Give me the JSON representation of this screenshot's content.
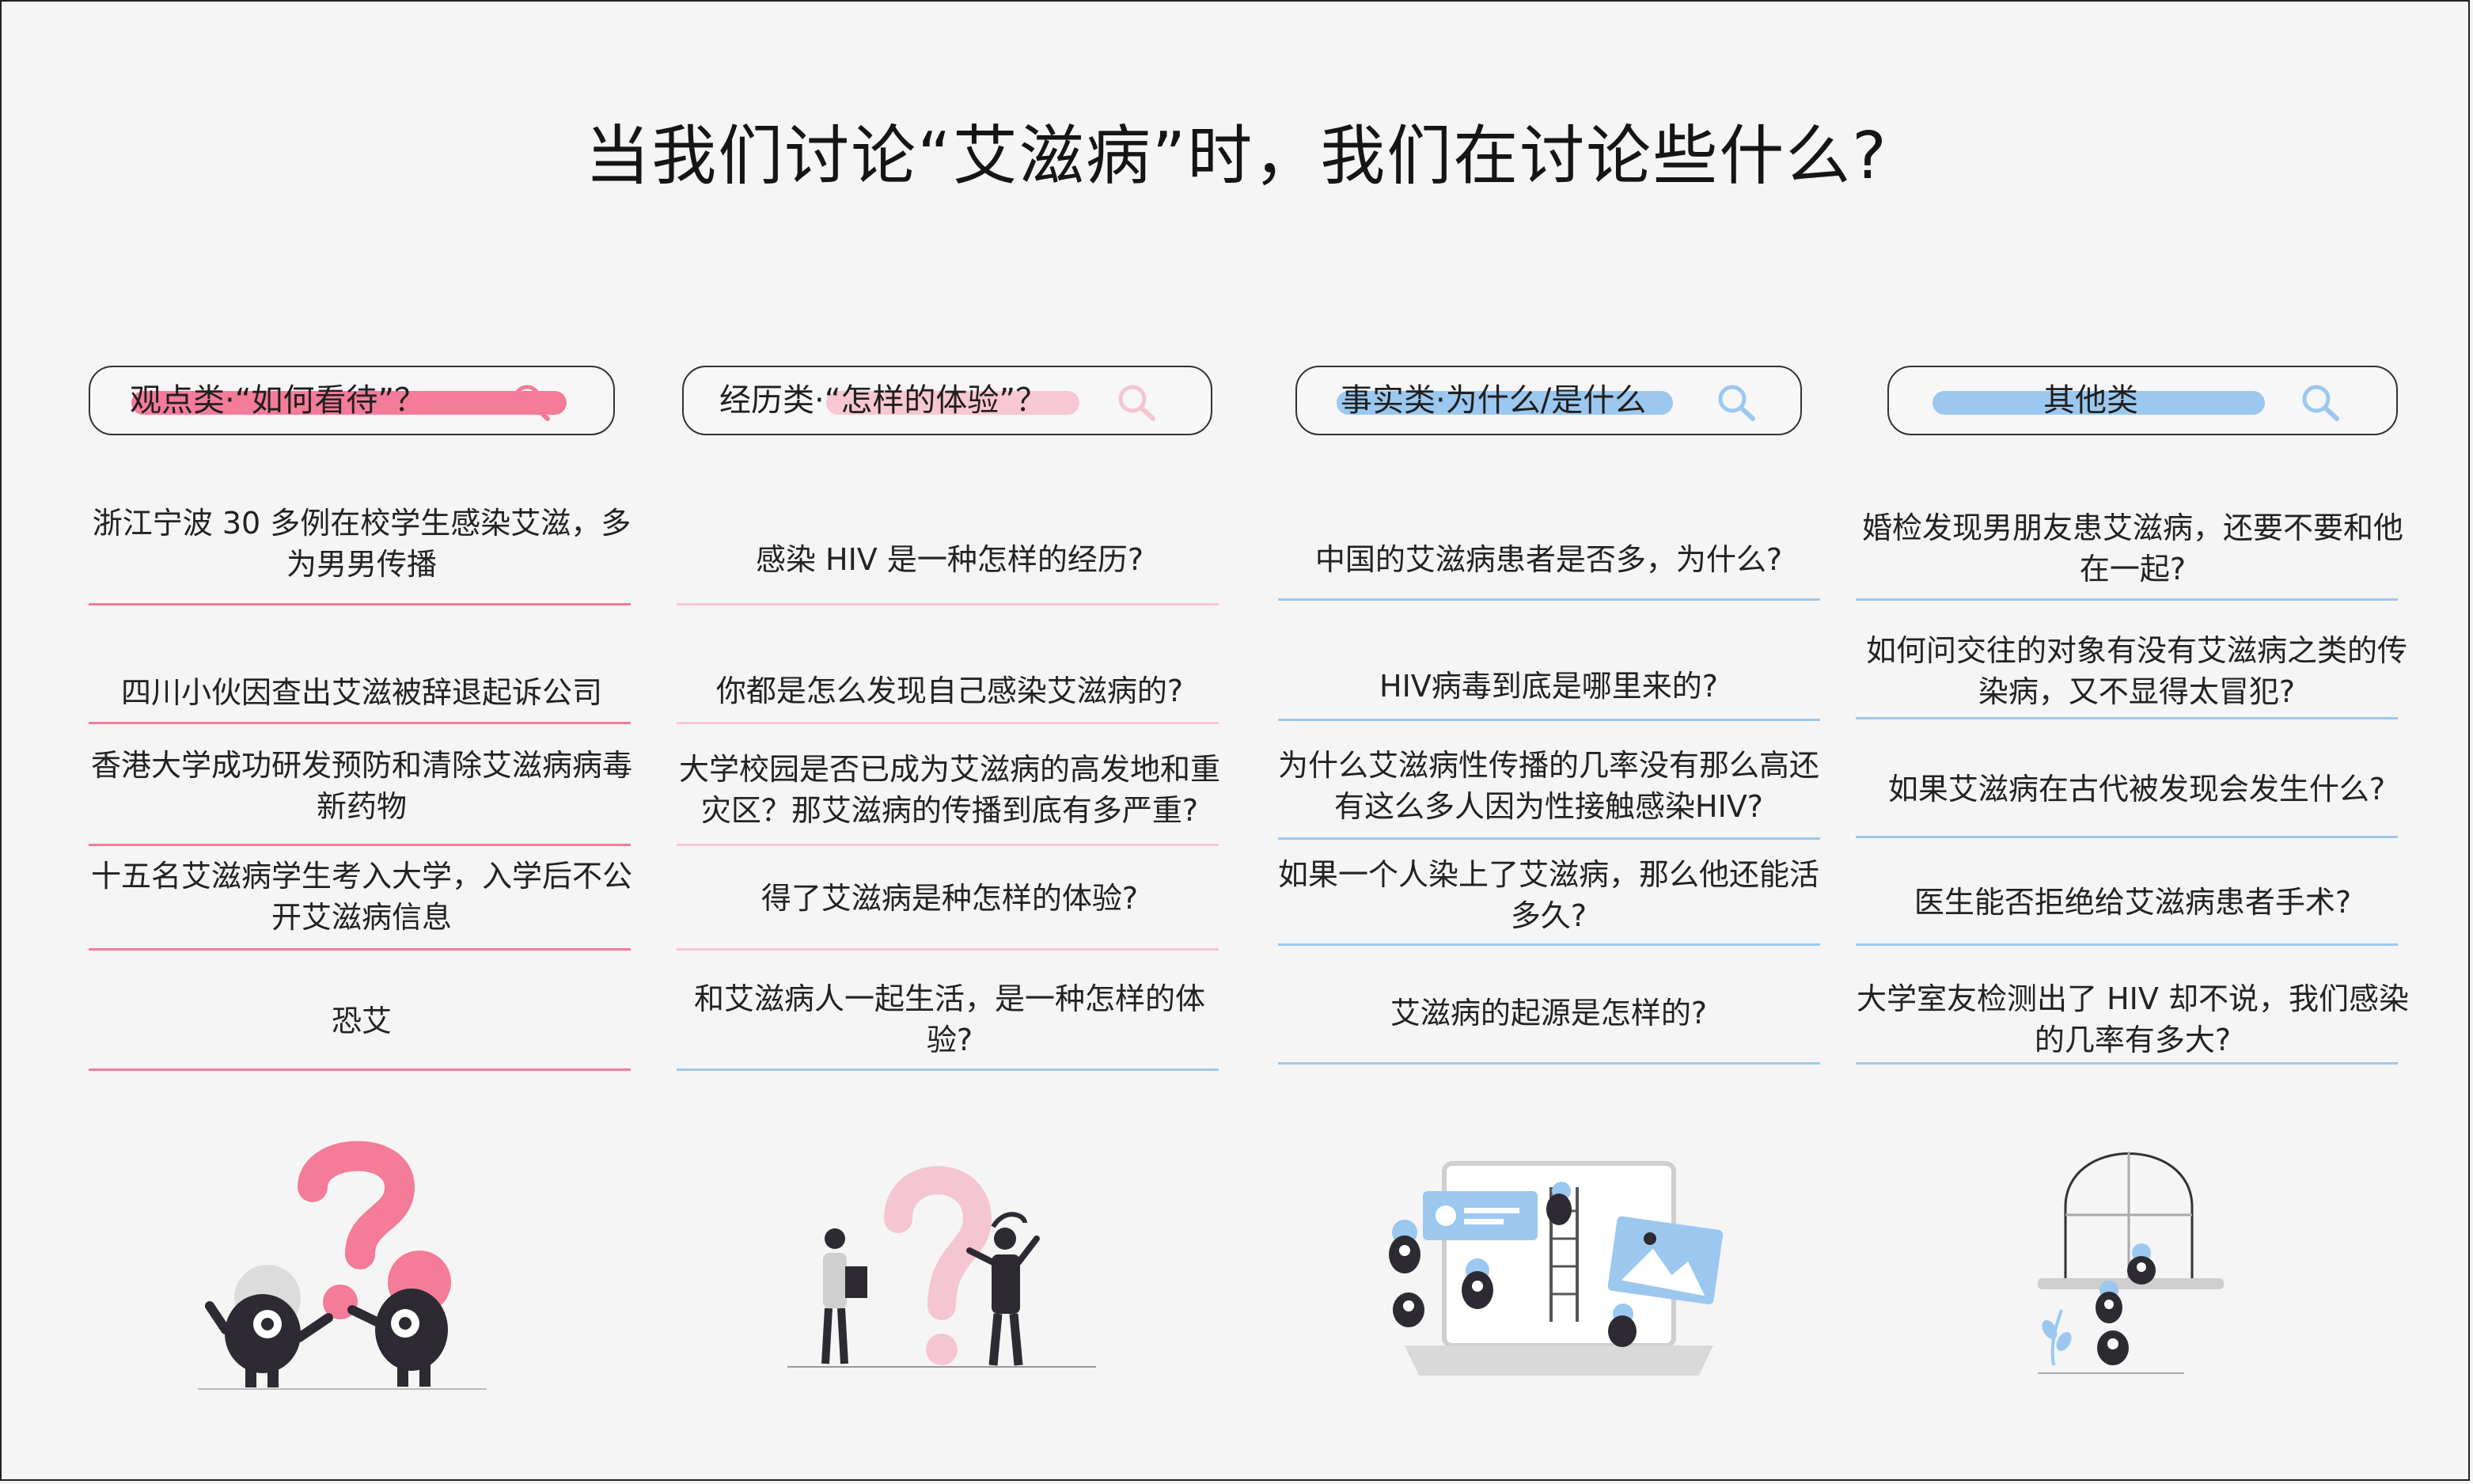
{
  "title": "当我们讨论“艾滋病”时，我们在讨论些什么?",
  "colors": {
    "pink": "#f47c99",
    "blue": "#9cc8ef",
    "light_pink": "#f4c6d2",
    "dark": "#2d2a32"
  },
  "columns": [
    {
      "search_label": "观点类·“如何看待”？",
      "icon": "search-icon",
      "items": [
        "浙江宁波 30 多例在校学生感染艾滋，多为男男传播",
        "四川小伙因查出艾滋被辞退起诉公司",
        "香港大学成功研发预防和清除艾滋病病毒新药物",
        "十五名艾滋病学生考入大学，入学后不公开艾滋病信息",
        "恐艾"
      ]
    },
    {
      "search_label": "经历类·“怎样的体验”？",
      "icon": "search-icon",
      "items": [
        "感染 HIV 是一种怎样的经历?",
        "你都是怎么发现自己感染艾滋病的?",
        "大学校园是否已成为艾滋病的高发地和重灾区？那艾滋病的传播到底有多严重?",
        "得了艾滋病是种怎样的体验?",
        "和艾滋病人一起生活，是一种怎样的体验?"
      ]
    },
    {
      "search_label": "事实类·为什么/是什么",
      "icon": "search-icon",
      "items": [
        "中国的艾滋病患者是否多，为什么?",
        "HIV病毒到底是哪里来的?",
        "为什么艾滋病性传播的几率没有那么高还有这么多人因为性接触感染HIV?",
        "如果一个人染上了艾滋病，那么他还能活多久?",
        "艾滋病的起源是怎样的?"
      ]
    },
    {
      "search_label": "其他类",
      "icon": "search-icon",
      "items": [
        "婚检发现男朋友患艾滋病，还要不要和他在一起?",
        "如何问交往的对象有没有艾滋病之类的传染病，又不显得太冒犯?",
        "如果艾滋病在古代被发现会发生什么?",
        "医生能否拒绝给艾滋病患者手术?",
        "大学室友检测出了 HIV 却不说，我们感染的几率有多大?"
      ]
    }
  ]
}
